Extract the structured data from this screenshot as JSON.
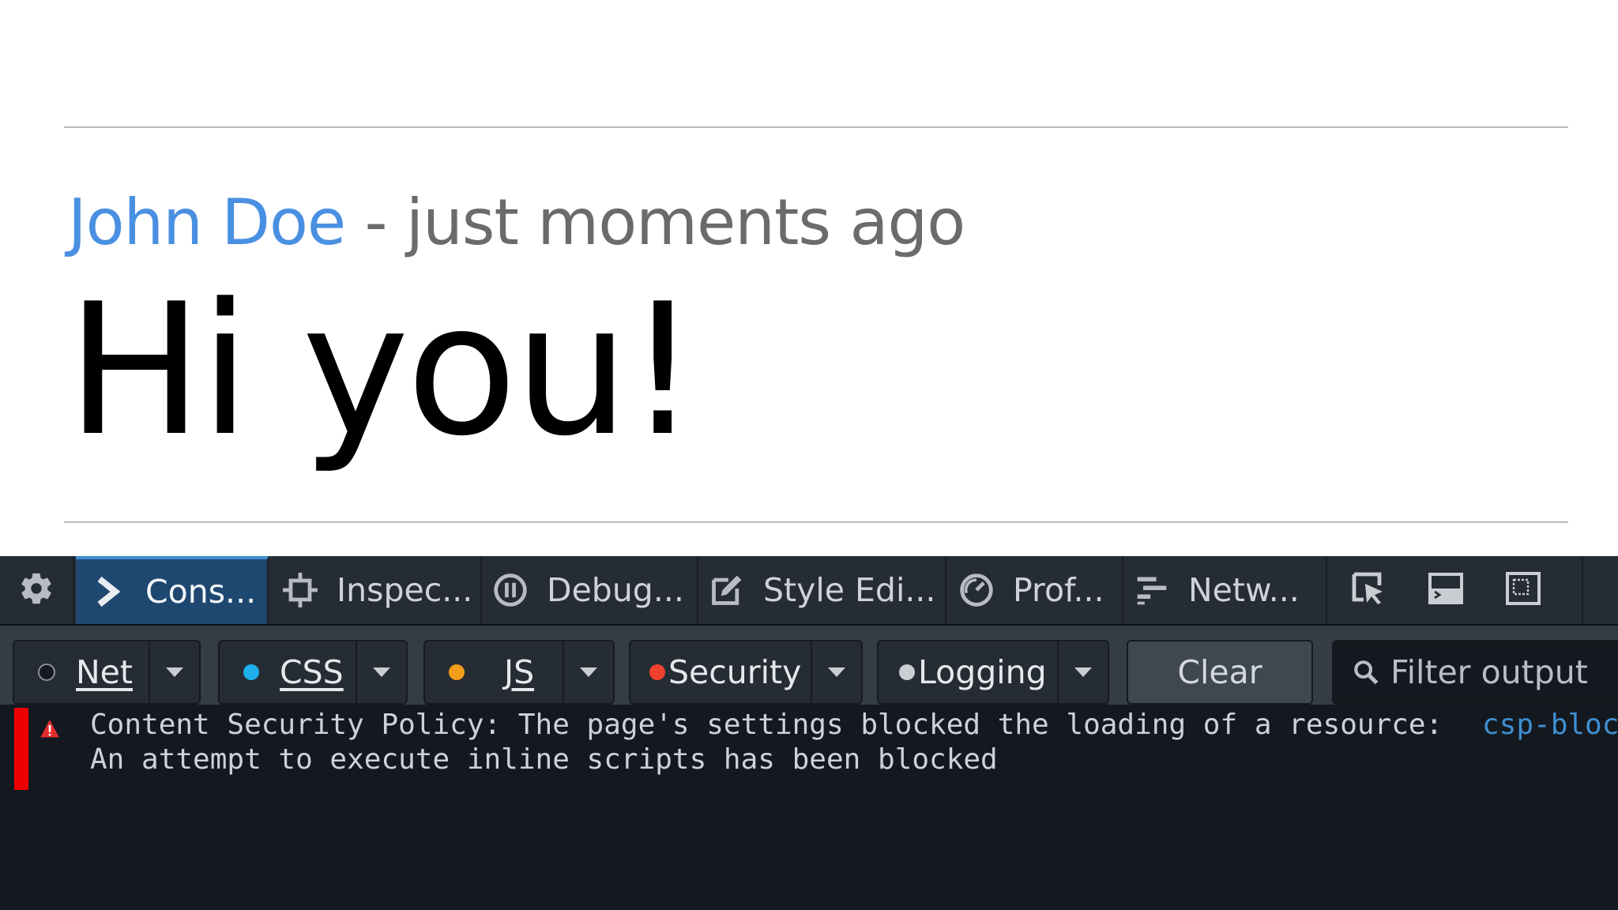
{
  "post": {
    "author": "John Doe",
    "meta": " - just moments ago",
    "message": "Hi you!"
  },
  "toolbar": {
    "tabs": [
      {
        "label": "Cons...",
        "icon": "console-icon",
        "selected": true
      },
      {
        "label": "Inspec...",
        "icon": "inspector-icon",
        "selected": false
      },
      {
        "label": "Debug...",
        "icon": "debugger-icon",
        "selected": false
      },
      {
        "label": "Style Edi...",
        "icon": "style-editor-icon",
        "selected": false
      },
      {
        "label": "Prof...",
        "icon": "profiler-icon",
        "selected": false
      },
      {
        "label": "Netw...",
        "icon": "network-icon",
        "selected": false
      }
    ],
    "options_icon": "gear-icon",
    "right_icons": [
      "pick-element-icon",
      "split-console-icon",
      "responsive-mode-icon"
    ]
  },
  "filters": {
    "net": {
      "label": "Net",
      "dot_color": "#14181f"
    },
    "css": {
      "label": "CSS",
      "dot_color": "#1fb0ec"
    },
    "js": {
      "label": "JS",
      "dot_color": "#f19f1b"
    },
    "security": {
      "label": "Security",
      "dot_color": "#f0402e"
    },
    "logging": {
      "label": "Logging",
      "dot_color": "#c9ced3"
    },
    "clear_label": "Clear",
    "filter_placeholder": "Filter output"
  },
  "console": {
    "messages": [
      {
        "severity": "error",
        "icon": "warning-icon",
        "line1": "Content Security Policy: The page's settings blocked the loading of a resource:",
        "line2": "An attempt to execute inline scripts has been blocked",
        "source": "csp-bloc"
      }
    ]
  },
  "colors": {
    "author": "#4a90e2",
    "selected_tab": "#1f4870",
    "error_marker": "#ee0000",
    "link": "#3e8fd2"
  }
}
